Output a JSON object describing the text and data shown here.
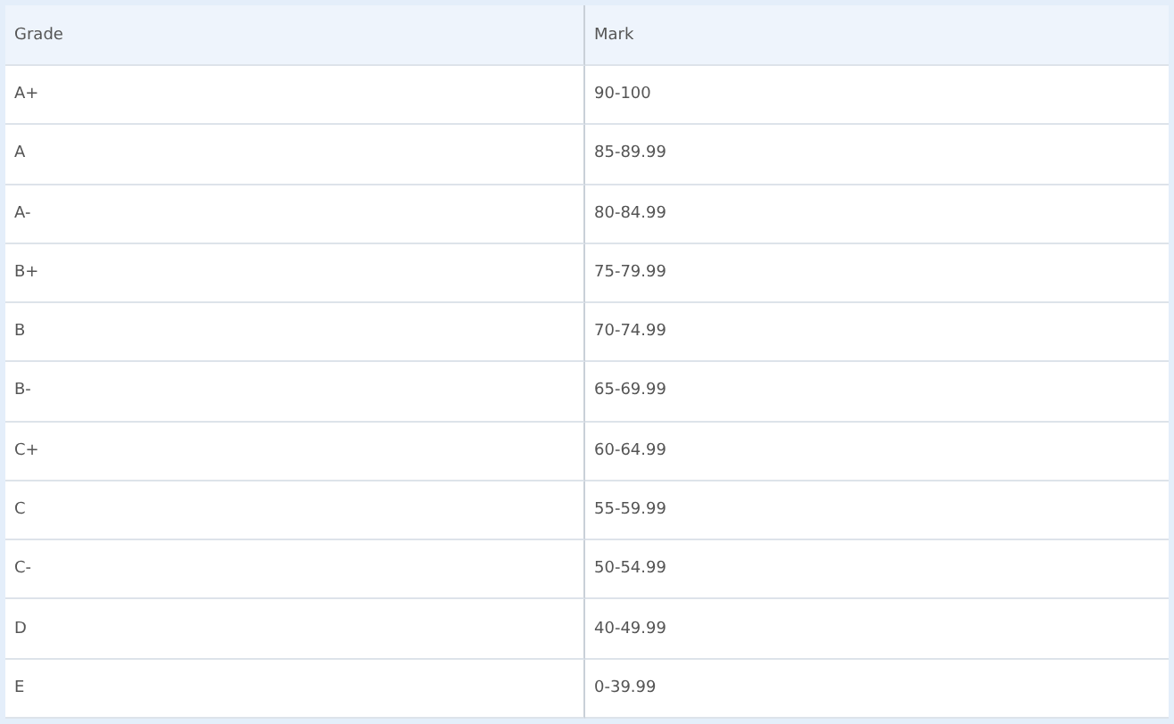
{
  "table": {
    "columns": [
      "Grade",
      "Mark"
    ],
    "rows": [
      [
        "A+",
        "90-100"
      ],
      [
        "A",
        "85-89.99"
      ],
      [
        "A-",
        "80-84.99"
      ],
      [
        "B+",
        "75-79.99"
      ],
      [
        "B",
        "70-74.99"
      ],
      [
        "B-",
        "65-69.99"
      ],
      [
        "C+",
        "60-64.99"
      ],
      [
        "C",
        "55-59.99"
      ],
      [
        "C-",
        "50-54.99"
      ],
      [
        "D",
        "40-49.99"
      ],
      [
        "E",
        "0-39.99"
      ]
    ]
  }
}
